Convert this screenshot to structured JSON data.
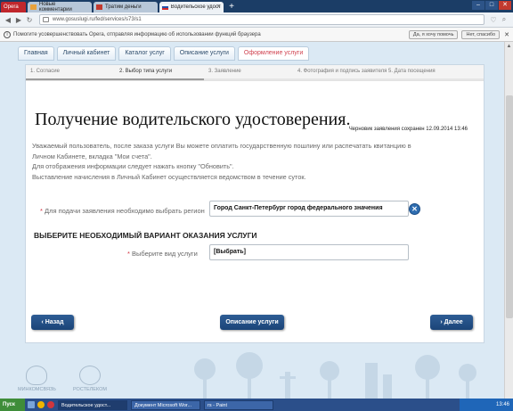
{
  "browser": {
    "menu_label": "Opera",
    "tabs": [
      {
        "label": "Новые комментарии",
        "active": false
      },
      {
        "label": "Тратим деньги",
        "active": false
      },
      {
        "label": "Водительское удостоверение",
        "active": true
      }
    ],
    "url": "www.gosuslugi.ru/fed/services/s73/s1",
    "infobar": {
      "text": "Помогите усовершенствовать Opera, отправляя информацию об использовании функций браузера",
      "yes_label": "Да, я хочу помочь",
      "no_label": "Нет, спасибо"
    }
  },
  "site_nav": {
    "tabs": [
      {
        "label": "Главная",
        "current": false
      },
      {
        "label": "Личный кабинет",
        "current": false
      },
      {
        "label": "Каталог услуг",
        "current": false
      },
      {
        "label": "Описание услуги",
        "current": false
      },
      {
        "label": "Оформление услуги",
        "current": true
      }
    ]
  },
  "steps": [
    {
      "label": "1. Согласие"
    },
    {
      "label": "2. Выбор типа услуги"
    },
    {
      "label": "3. Заявление"
    },
    {
      "label": "4. Фотография и подпись заявителя"
    },
    {
      "label": "5. Дата посещения"
    }
  ],
  "form": {
    "title": "Получение водительского удостоверения.",
    "draft_status": "Черновик заявления сохранен 12.09.2014 13:46",
    "info_lines": [
      "Уважаемый пользователь, после заказа услуги Вы можете оплатить государственную пошлину или распечатать квитанцию в",
      "Личном Кабинете, вкладка \"Мои счета\".",
      "Для отображения информации следует нажать кнопку \"Обновить\".",
      "Выставление начисления в Личный Кабинет осуществляется ведомством в течение суток."
    ],
    "region_label": "Для подачи заявления необходимо выбрать регион",
    "region_value": "Город Санкт-Петербург город федерального значения",
    "section_heading": "ВЫБЕРИТЕ НЕОБХОДИМЫЙ ВАРИАНТ ОКАЗАНИЯ УСЛУГИ",
    "service_label": "Выберите вид услуги",
    "service_value": "[Выбрать]",
    "required_mark": "*"
  },
  "buttons": {
    "back": "Назад",
    "description": "Описание услуги",
    "next": "Далее"
  },
  "footer": {
    "logo1": "МИНКОМСВЯЗЬ",
    "logo2": "РОСТЕЛЕКОМ"
  },
  "taskbar": {
    "start_label": "Пуск",
    "tasks": [
      {
        "label": "Водительское удост...",
        "active": true
      },
      {
        "label": "Документ Microsoft Wor...",
        "active": false
      },
      {
        "label": "rs - Paint",
        "active": false
      }
    ],
    "clock": "13:46"
  }
}
